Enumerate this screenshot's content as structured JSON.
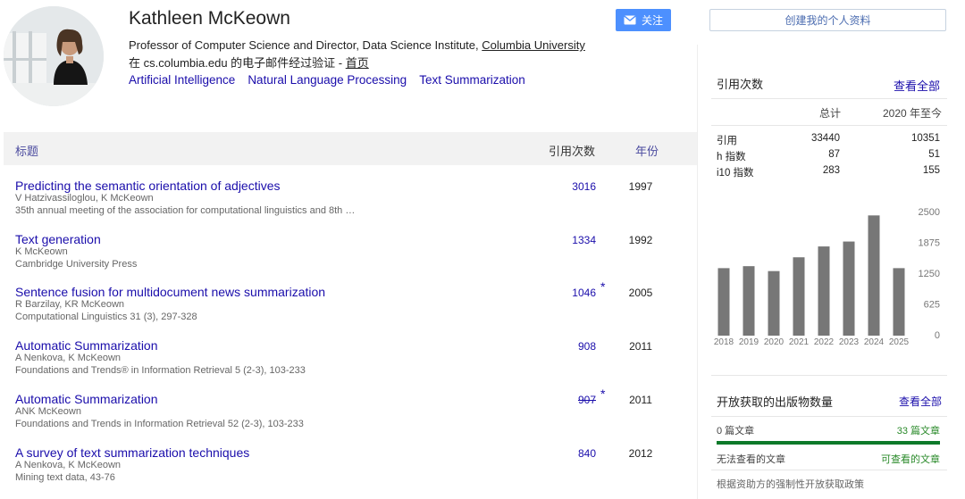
{
  "profile": {
    "name": "Kathleen McKeown",
    "affiliation_prefix": "Professor of Computer Science and Director, Data Science Institute, ",
    "affiliation_link": "Columbia University",
    "email_text": "在 cs.columbia.edu 的电子邮件经过验证 - ",
    "homepage_link": "首页",
    "interests": [
      "Artificial Intelligence",
      "Natural Language Processing",
      "Text Summarization"
    ]
  },
  "actions": {
    "follow_label": "关注",
    "create_profile_label": "创建我的个人资料"
  },
  "table": {
    "header_title": "标题",
    "header_cited": "引用次数",
    "header_year": "年份",
    "rows": [
      {
        "title": "Predicting the semantic orientation of adjectives",
        "authors": "V Hatzivassiloglou, K McKeown",
        "venue": "35th annual meeting of the association for computational linguistics and 8th …",
        "cites": "3016",
        "star": "",
        "year": "1997"
      },
      {
        "title": "Text generation",
        "authors": "K McKeown",
        "venue": "Cambridge University Press",
        "cites": "1334",
        "star": "",
        "year": "1992"
      },
      {
        "title": "Sentence fusion for multidocument news summarization",
        "authors": "R Barzilay, KR McKeown",
        "venue": "Computational Linguistics 31 (3), 297-328",
        "cites": "1046",
        "star": "*",
        "year": "2005"
      },
      {
        "title": "Automatic Summarization",
        "authors": "A Nenkova, K McKeown",
        "venue": "Foundations and Trends® in Information Retrieval 5 (2-3), 103-233",
        "cites": "908",
        "star": "",
        "year": "2011"
      },
      {
        "title": "Automatic Summarization",
        "authors": "ANK McKeown",
        "venue": "Foundations and Trends in Information Retrieval 52 (2-3), 103-233",
        "cites": "907",
        "star": "*",
        "year": "2011"
      },
      {
        "title": "A survey of text summarization techniques",
        "authors": "A Nenkova, K McKeown",
        "venue": "Mining text data, 43-76",
        "cites": "840",
        "star": "",
        "year": "2012"
      }
    ]
  },
  "cited_by": {
    "title": "引用次数",
    "view_all": "查看全部",
    "col_all": "总计",
    "col_since": "2020 年至今",
    "stats": [
      {
        "label": "引用",
        "all": "33440",
        "since": "10351"
      },
      {
        "label": "h 指数",
        "all": "87",
        "since": "51"
      },
      {
        "label": "i10 指数",
        "all": "283",
        "since": "155"
      }
    ]
  },
  "chart_data": {
    "type": "bar",
    "categories": [
      "2018",
      "2019",
      "2020",
      "2021",
      "2022",
      "2023",
      "2024",
      "2025"
    ],
    "values": [
      1370,
      1410,
      1310,
      1590,
      1810,
      1910,
      2440,
      1370
    ],
    "yticks": [
      "2500",
      "1875",
      "1250",
      "625",
      "0"
    ],
    "ylim": [
      0,
      2500
    ]
  },
  "open_access": {
    "title": "开放获取的出版物数量",
    "view_all": "查看全部",
    "unavailable_count": "0 篇文章",
    "available_count": "33 篇文章",
    "unavailable_label": "无法查看的文章",
    "available_label": "可查看的文章",
    "note": "根据资助方的强制性开放获取政策"
  }
}
